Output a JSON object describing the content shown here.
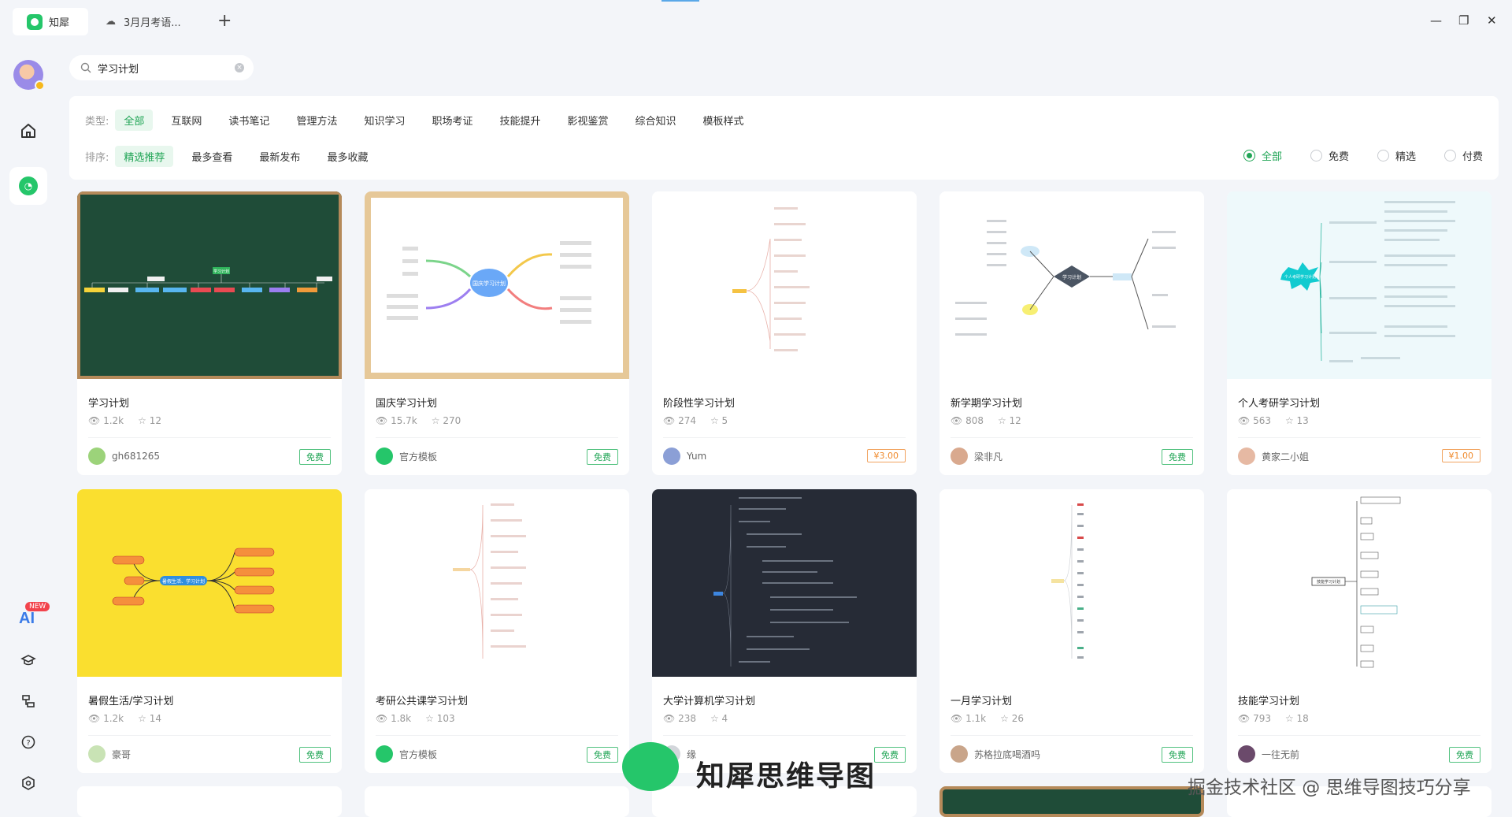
{
  "tabs": [
    {
      "label": "知犀"
    },
    {
      "label": "3月月考语..."
    }
  ],
  "search": {
    "value": "学习计划"
  },
  "filters": {
    "type_label": "类型:",
    "types": [
      "全部",
      "互联网",
      "读书笔记",
      "管理方法",
      "知识学习",
      "职场考证",
      "技能提升",
      "影视鉴赏",
      "综合知识",
      "模板样式"
    ],
    "sort_label": "排序:",
    "sorts": [
      "精选推荐",
      "最多查看",
      "最新发布",
      "最多收藏"
    ],
    "price_options": [
      "全部",
      "免费",
      "精选",
      "付费"
    ]
  },
  "sidebar": {
    "ai_label": "AI",
    "new_badge": "NEW"
  },
  "cards": [
    {
      "title": "学习计划",
      "views": "1.2k",
      "stars": "12",
      "author": "gh681265",
      "price": "免费",
      "paid": false
    },
    {
      "title": "国庆学习计划",
      "views": "15.7k",
      "stars": "270",
      "author": "官方模板",
      "price": "免费",
      "paid": false
    },
    {
      "title": "阶段性学习计划",
      "views": "274",
      "stars": "5",
      "author": "Yum",
      "price": "¥3.00",
      "paid": true
    },
    {
      "title": "新学期学习计划",
      "views": "808",
      "stars": "12",
      "author": "梁非凡",
      "price": "免费",
      "paid": false
    },
    {
      "title": "个人考研学习计划",
      "views": "563",
      "stars": "13",
      "author": "黄家二小姐",
      "price": "¥1.00",
      "paid": true
    },
    {
      "title": "暑假生活/学习计划",
      "views": "1.2k",
      "stars": "14",
      "author": "豪哥",
      "price": "免费",
      "paid": false
    },
    {
      "title": "考研公共课学习计划",
      "views": "1.8k",
      "stars": "103",
      "author": "官方模板",
      "price": "免费",
      "paid": false
    },
    {
      "title": "大学计算机学习计划",
      "views": "238",
      "stars": "4",
      "author": "缘",
      "price": "免费",
      "paid": false
    },
    {
      "title": "一月学习计划",
      "views": "1.1k",
      "stars": "26",
      "author": "苏格拉底喝酒吗",
      "price": "免费",
      "paid": false
    },
    {
      "title": "技能学习计划",
      "views": "793",
      "stars": "18",
      "author": "一往无前",
      "price": "免费",
      "paid": false
    }
  ],
  "thumb_text": {
    "c1_center": "学习计划",
    "c2_center": "国庆学习计划",
    "c4_center": "学习计划",
    "c5_center": "个人考研学习计划",
    "c6_center": "暑假生活、学习计划",
    "c10_center": "技能学习计划"
  },
  "watermark": {
    "title": "知犀思维导图",
    "right": "掘金技术社区 @ 思维导图技巧分享"
  },
  "colors": {
    "accent": "#21a556",
    "paid": "#ef8a2c"
  }
}
